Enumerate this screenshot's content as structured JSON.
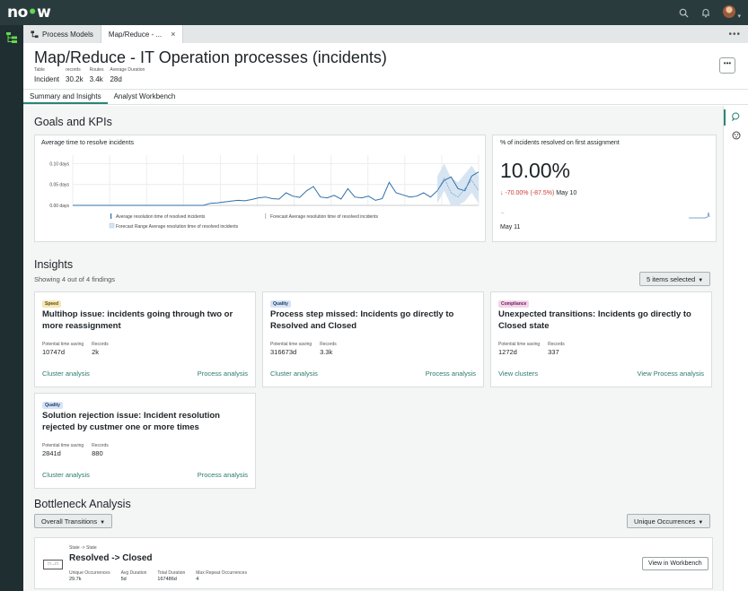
{
  "brand": {
    "logo_main": "no",
    "logo_w": "w"
  },
  "tabs": [
    {
      "label": "Process Models"
    },
    {
      "label": "Map/Reduce - ...",
      "close": "×"
    }
  ],
  "tabs_more": "•••",
  "header": {
    "title": "Map/Reduce - IT Operation processes (incidents)",
    "meta": [
      {
        "label": "Table",
        "value": "Incident"
      },
      {
        "label": "records",
        "value": "30.2k"
      },
      {
        "label": "Routes",
        "value": "3.4k"
      },
      {
        "label": "Average Duration",
        "value": "28d"
      }
    ],
    "more": "•••"
  },
  "subtabs": [
    "Summary and Insights",
    "Analyst Workbench"
  ],
  "goals": {
    "title": "Goals and KPIs",
    "chart_title": "Average time to resolve incidents",
    "kpi": {
      "title": "% of incidents resolved on first assignment",
      "value": "10.00%",
      "delta_arrow": "↓",
      "delta": "-70.00% (-87.5%)",
      "delta_date": "May 10",
      "date": "May 11",
      "spark_tick": "–"
    }
  },
  "chart_data": {
    "type": "line",
    "title": "Average time to resolve incidents",
    "y_ticks": [
      "0.10 days",
      "0.05 days",
      "0.00 days"
    ],
    "ylim": [
      0,
      0.12
    ],
    "x": [
      0,
      1,
      2,
      3,
      4,
      5,
      6,
      7,
      8,
      9,
      10,
      11,
      12,
      13,
      14,
      15,
      16,
      17,
      18,
      19,
      20,
      21,
      22,
      23,
      24,
      25,
      26,
      27,
      28,
      29,
      30,
      31,
      32,
      33,
      34,
      35,
      36,
      37,
      38,
      39,
      40,
      41,
      42,
      43,
      44,
      45,
      46,
      47,
      48,
      49,
      50,
      51,
      52,
      53,
      54,
      55,
      56,
      57,
      58,
      59
    ],
    "series": [
      {
        "name": "Average resolution time of resolved incidents",
        "color": "#2f6fa8",
        "values": [
          0,
          0,
          0,
          0,
          0,
          0,
          0,
          0,
          0,
          0,
          0,
          0,
          0,
          0,
          0,
          0,
          0,
          0,
          0,
          0,
          0.005,
          0.006,
          0.008,
          0.01,
          0.012,
          0.011,
          0.014,
          0.018,
          0.02,
          0.016,
          0.015,
          0.03,
          0.022,
          0.019,
          0.035,
          0.045,
          0.02,
          0.018,
          0.024,
          0.015,
          0.04,
          0.02,
          0.018,
          0.022,
          0.012,
          0.016,
          0.055,
          0.03,
          0.025,
          0.02,
          0.022,
          0.03,
          0.02,
          0.035,
          0.06,
          0.068,
          0.04,
          0.035,
          0.07,
          0.08
        ]
      },
      {
        "name": "Forecast Average resolution time of resolved incidents",
        "color": "#7aa6cf",
        "values": [
          null,
          null,
          null,
          null,
          null,
          null,
          null,
          null,
          null,
          null,
          null,
          null,
          null,
          null,
          null,
          null,
          null,
          null,
          null,
          null,
          null,
          null,
          null,
          null,
          null,
          null,
          null,
          null,
          null,
          null,
          null,
          null,
          null,
          null,
          null,
          null,
          null,
          null,
          null,
          null,
          null,
          null,
          null,
          null,
          null,
          null,
          null,
          null,
          null,
          null,
          null,
          null,
          null,
          0.035,
          0.065,
          0.03,
          0.02,
          0.04,
          0.06,
          0.035
        ]
      }
    ],
    "band_name": "Forecast Range Average resolution time of resolved incidents",
    "band_color": "#d7e5f2",
    "legend": "bottom"
  },
  "insights": {
    "title": "Insights",
    "subtitle": "Showing 4 out of 4 findings",
    "filter_label": "5 items selected",
    "stat_label_saving": "Potential time saving",
    "stat_label_records": "Records",
    "cards": [
      {
        "badge": "Speed",
        "title": "Multihop issue: incidents going through two or more reassignment",
        "saving": "10747d",
        "records": "2k",
        "link_left": "Cluster analysis",
        "link_right": "Process analysis"
      },
      {
        "badge": "Quality",
        "title": "Process step missed: Incidents go directly to Resolved and Closed",
        "saving": "316673d",
        "records": "3.3k",
        "link_left": "Cluster analysis",
        "link_right": "Process analysis"
      },
      {
        "badge": "Compliance",
        "title": "Unexpected transitions: Incidents go directly to Closed state",
        "saving": "1272d",
        "records": "337",
        "link_left": "View clusters",
        "link_right": "View Process analysis"
      },
      {
        "badge": "Quality",
        "title": "Solution rejection issue: Incident resolution rejected by custmer one or more times",
        "saving": "2841d",
        "records": "880",
        "link_left": "Cluster analysis",
        "link_right": "Process analysis"
      }
    ]
  },
  "bottleneck": {
    "title": "Bottleneck Analysis",
    "left_dropdown": "Overall Transitions",
    "right_dropdown": "Unique Occurrences",
    "row": {
      "icon_text": "□→□",
      "label": "State -> State",
      "title": "Resolved -> Closed",
      "stats": [
        {
          "label": "Unique Occurrences",
          "value": "29.7k"
        },
        {
          "label": "Avg Duration",
          "value": "5d"
        },
        {
          "label": "Total Duration",
          "value": "167486d"
        },
        {
          "label": "Max Repeat Occurrences",
          "value": "4"
        }
      ],
      "button": "View in Workbench"
    }
  },
  "colors": {
    "accent": "#2a8575",
    "nav": "#2a3b3e",
    "negative": "#c83c36"
  }
}
